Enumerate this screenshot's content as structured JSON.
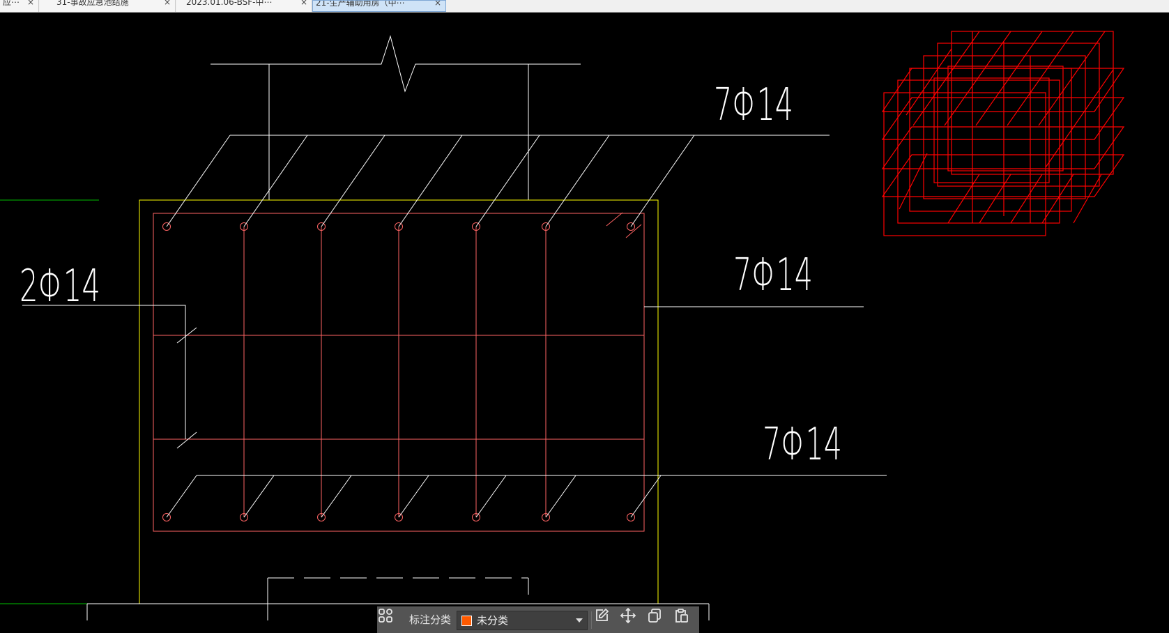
{
  "tabs": [
    {
      "label": "应⋯",
      "active": false
    },
    {
      "label": "31-事故应急池结施",
      "active": false
    },
    {
      "label": "2023.01.06-BSF-中⋯",
      "active": false
    },
    {
      "label": "21-生产辅助用房（中⋯",
      "active": true
    }
  ],
  "tab_close_glyph": "×",
  "drawing": {
    "annotations": {
      "top_bars": "7Φ14",
      "middle_bars": "7Φ14",
      "bottom_bars": "7Φ14",
      "side_bars": "2Φ14"
    },
    "colors": {
      "background": "#000000",
      "outline": "#ffff00",
      "rebar": "#ff5a5a",
      "leader": "#ffffff",
      "cube": "#ff0000",
      "axis": "#00c000"
    }
  },
  "toolbar": {
    "category_label": "标注分类",
    "category_value": "未分类",
    "swatch_color": "#ff5a00",
    "icons": [
      "grid-icon",
      "edit-icon",
      "move-icon",
      "copy-icon",
      "paste-icon"
    ]
  }
}
